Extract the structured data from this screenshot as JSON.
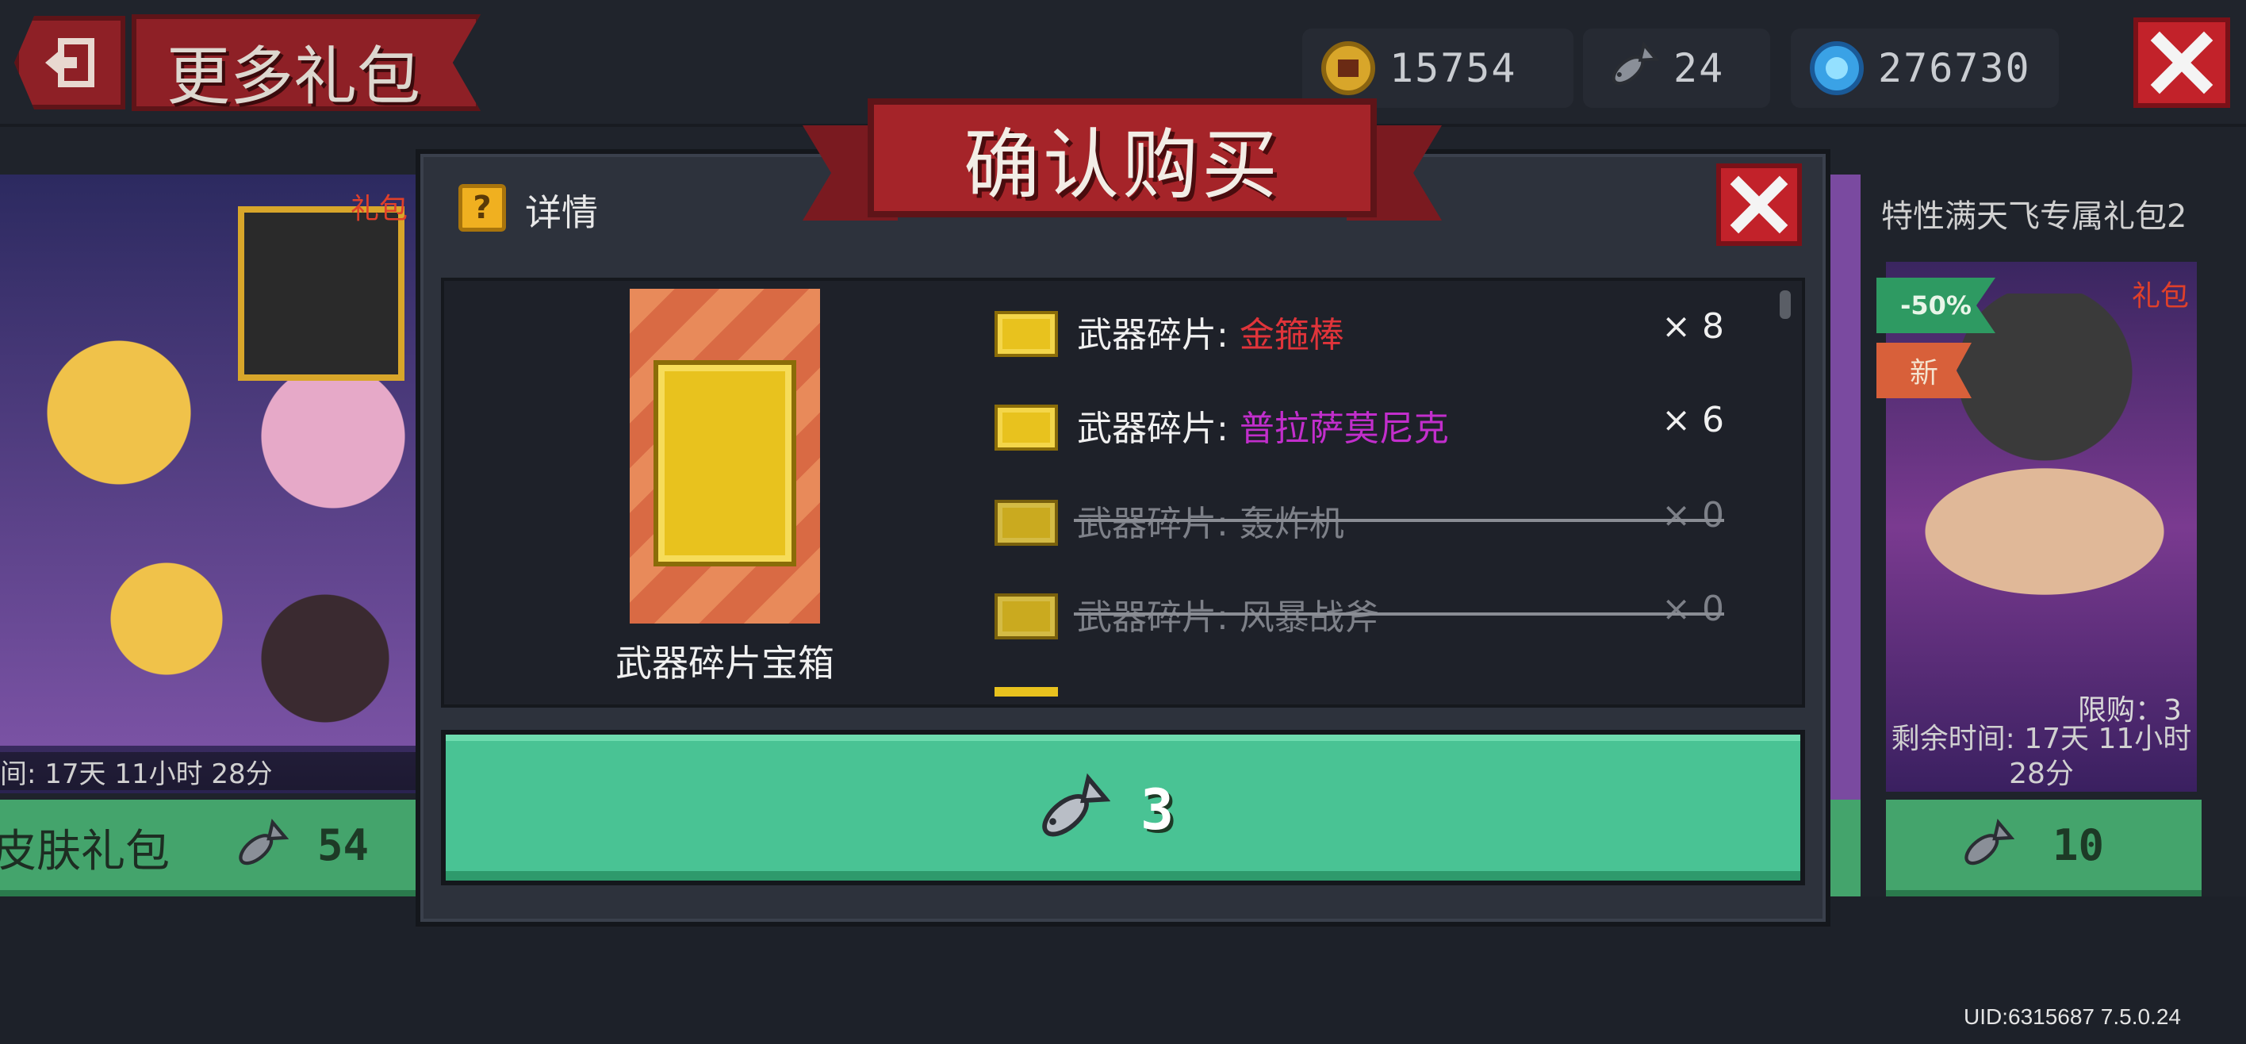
{
  "header": {
    "title": "更多礼包",
    "coins": "15754",
    "fish": "24",
    "gems": "276730"
  },
  "left_card": {
    "tag": "礼包",
    "time": "间: 17天 11小时 28分",
    "name": "皮肤礼包",
    "price": "54"
  },
  "right_card": {
    "title": "特性满天飞专属礼包2",
    "tag": "礼包",
    "discount": "-50%",
    "new_tag": "新",
    "limit": "限购：3",
    "time_line1": "剩余时间: 17天 11小时",
    "time_line2": "28分",
    "price": "10"
  },
  "dialog": {
    "title": "确认购买",
    "detail_label": "详情",
    "box_name": "武器碎片宝箱",
    "items": [
      {
        "label": "武器碎片: ",
        "name": "金箍棒",
        "qty": "× 8",
        "color": "#e0343a",
        "available": true
      },
      {
        "label": "武器碎片: ",
        "name": "普拉萨莫尼克",
        "qty": "× 6",
        "color": "#c22ecc",
        "available": true
      },
      {
        "label": "武器碎片: ",
        "name": "轰炸机",
        "qty": "× 0",
        "available": false
      },
      {
        "label": "武器碎片: ",
        "name": "风暴战斧",
        "qty": "× 0",
        "available": false
      }
    ],
    "price": "3"
  },
  "footer": {
    "uid": "UID:6315687 7.5.0.24"
  },
  "icons": {
    "back": "exit-icon",
    "coin": "coin-icon",
    "fish": "fish-icon",
    "gem": "gem-icon",
    "close": "close-icon",
    "help": "question-icon"
  }
}
